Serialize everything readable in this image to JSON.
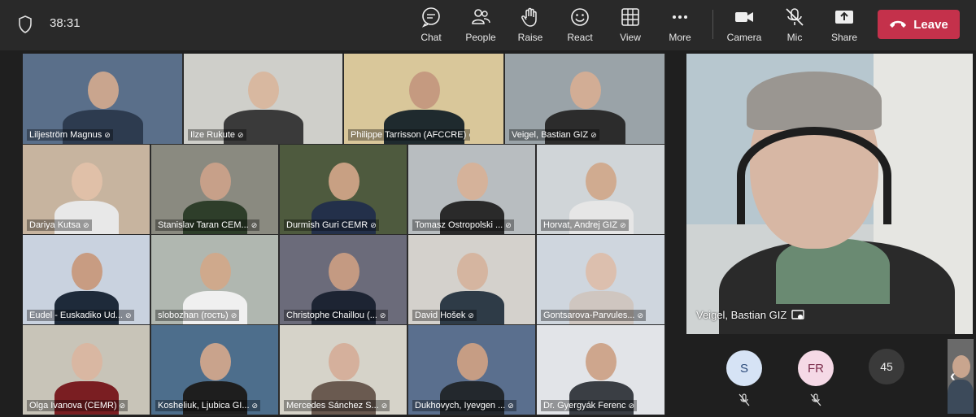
{
  "topbar": {
    "timer": "38:31",
    "buttons": [
      {
        "label": "Chat",
        "icon": "chat-icon"
      },
      {
        "label": "People",
        "icon": "people-icon"
      },
      {
        "label": "Raise",
        "icon": "raise-hand-icon"
      },
      {
        "label": "React",
        "icon": "react-icon"
      },
      {
        "label": "View",
        "icon": "view-grid-icon"
      },
      {
        "label": "More",
        "icon": "more-icon"
      },
      {
        "label": "Camera",
        "icon": "camera-icon"
      },
      {
        "label": "Mic",
        "icon": "mic-muted-icon"
      },
      {
        "label": "Share",
        "icon": "share-icon"
      }
    ],
    "leave_label": "Leave",
    "leave_color": "#c4314b"
  },
  "grid": {
    "tiles": [
      {
        "name": "Liljeström Magnus"
      },
      {
        "name": "Ilze Rukute"
      },
      {
        "name": "Philippe Tarrisson (AFCCRE)"
      },
      {
        "name": "Veigel, Bastian GIZ"
      },
      {
        "name": "Dariya Kutsa"
      },
      {
        "name": "Stanislav Taran CEM..."
      },
      {
        "name": "Durmish Guri CEMR"
      },
      {
        "name": "Tomasz Ostropolski ..."
      },
      {
        "name": "Horvat, Andrej GIZ"
      },
      {
        "name": "Eudel - Euskadiko Ud..."
      },
      {
        "name": "slobozhan (гость)"
      },
      {
        "name": "Christophe Chaillou (..."
      },
      {
        "name": "David Hošek"
      },
      {
        "name": "Gontsarova-Parvules..."
      },
      {
        "name": "Olga Ivanova (CEMR)"
      },
      {
        "name": "Kosheliuk, Ljubica GI..."
      },
      {
        "name": "Mercedes Sánchez S..."
      },
      {
        "name": "Dukhovych, Iyevgen ..."
      },
      {
        "name": "Dr. Gyergyák Ferenc"
      }
    ]
  },
  "featured": {
    "name": "Veigel, Bastian GIZ"
  },
  "participants": [
    {
      "initials": "S",
      "bg": "#d6e3f5",
      "color": "#2b4a7a"
    },
    {
      "initials": "FR",
      "bg": "#f5d9e6",
      "color": "#7a2b4a"
    }
  ],
  "more_count": "45"
}
